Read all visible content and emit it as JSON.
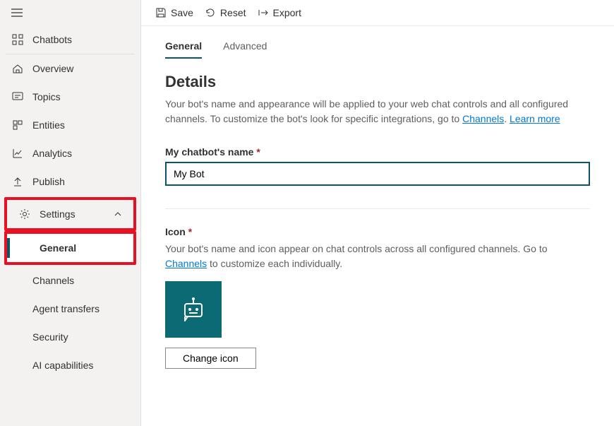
{
  "toolbar": {
    "save": "Save",
    "reset": "Reset",
    "export": "Export"
  },
  "sidebar": {
    "chatbots": "Chatbots",
    "overview": "Overview",
    "topics": "Topics",
    "entities": "Entities",
    "analytics": "Analytics",
    "publish": "Publish",
    "settings": "Settings",
    "general": "General",
    "channels": "Channels",
    "agent_transfers": "Agent transfers",
    "security": "Security",
    "ai_capabilities": "AI capabilities"
  },
  "tabs": {
    "general": "General",
    "advanced": "Advanced"
  },
  "details": {
    "heading": "Details",
    "desc_1": "Your bot's name and appearance will be applied to your web chat controls and all configured channels. To customize the bot's look for specific integrations, go to ",
    "channels_link": "Channels",
    "sep": ". ",
    "learn_more": "Learn more",
    "name_label": "My chatbot's name ",
    "name_value": "My Bot",
    "icon_label": "Icon ",
    "icon_desc_1": "Your bot's name and icon appear on chat controls across all configured channels. Go to ",
    "icon_desc_2": " to customize each individually.",
    "change_icon": "Change icon"
  }
}
